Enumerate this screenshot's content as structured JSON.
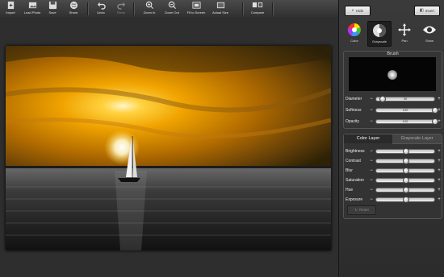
{
  "toolbar": {
    "buttons": [
      {
        "label": "Import",
        "icon": "import-icon"
      },
      {
        "label": "Load Photo",
        "icon": "load-photo-icon"
      },
      {
        "label": "Save",
        "icon": "save-icon"
      },
      {
        "label": "Share",
        "icon": "share-icon"
      },
      {
        "label": "Undo",
        "icon": "undo-icon"
      },
      {
        "label": "Redo",
        "icon": "redo-icon",
        "disabled": true
      },
      {
        "label": "Zoom In",
        "icon": "zoom-in-icon"
      },
      {
        "label": "Zoom Out",
        "icon": "zoom-out-icon"
      },
      {
        "label": "Fit to Screen",
        "icon": "fit-to-screen-icon"
      },
      {
        "label": "Actual Size",
        "icon": "actual-size-icon"
      },
      {
        "label": "Compare",
        "icon": "compare-icon"
      }
    ]
  },
  "panel": {
    "top_left_button": "Hide",
    "top_right_button": "Invert",
    "modes": [
      {
        "label": "Color",
        "icon": "color-wheel-icon"
      },
      {
        "label": "Grayscale",
        "icon": "grayscale-icon",
        "active": true
      },
      {
        "label": "Pan",
        "icon": "pan-icon"
      },
      {
        "label": "Show",
        "icon": "eye-icon"
      }
    ],
    "brush": {
      "title": "Brush",
      "sliders": [
        {
          "name": "Diameter",
          "value": "30",
          "level": 0.1
        },
        {
          "name": "Softness",
          "value": "100",
          "level": 1.0
        },
        {
          "name": "Opacity",
          "value": "100",
          "level": 1.0
        }
      ]
    },
    "layer_tabs": [
      "Color Layer",
      "Grayscale Layer"
    ],
    "adjustments": [
      {
        "name": "Brightness",
        "level": 0.5
      },
      {
        "name": "Contrast",
        "level": 0.5
      },
      {
        "name": "Blur",
        "value": "0",
        "level": 0.5
      },
      {
        "name": "Saturation",
        "level": 0.5
      },
      {
        "name": "Hue",
        "level": 0.5
      },
      {
        "name": "Exposure",
        "level": 0.5
      }
    ],
    "reset_button": "Reset"
  },
  "colors": {
    "sky_top": "#4a3a0e",
    "sky_glow": "#f0a300",
    "sun": "#fffbe0",
    "water": "#222222"
  }
}
